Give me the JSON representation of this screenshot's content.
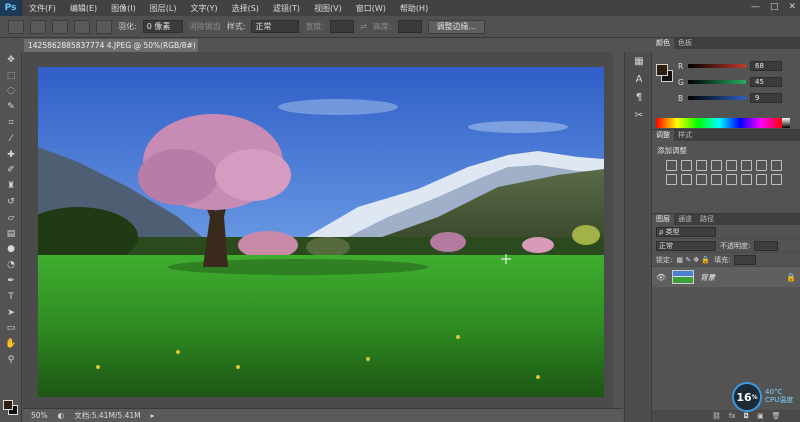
{
  "app": {
    "logo": "Ps"
  },
  "menu": [
    "文件(F)",
    "编辑(E)",
    "图像(I)",
    "图层(L)",
    "文字(Y)",
    "选择(S)",
    "滤镜(T)",
    "视图(V)",
    "窗口(W)",
    "帮助(H)"
  ],
  "window_controls": [
    "—",
    "□",
    "✕"
  ],
  "options": {
    "feather_label": "羽化:",
    "feather_value": "0 像素",
    "antialias_label": "消除锯齿",
    "style_label": "样式:",
    "style_value": "正常",
    "width_label": "宽度:",
    "height_label": "高度:",
    "refine_edge_button": "调整边缘..."
  },
  "document": {
    "tab_title": "1425862885837774 4.JPEG @ 50%(RGB/8#)",
    "close_icon": "×",
    "zoom": "50%",
    "doc_info": "文档:5.41M/5.41M"
  },
  "tools": [
    "move-tool",
    "marquee-tool",
    "lasso-tool",
    "quick-select-tool",
    "crop-tool",
    "eyedropper-tool",
    "healing-brush-tool",
    "brush-tool",
    "clone-stamp-tool",
    "history-brush-tool",
    "eraser-tool",
    "gradient-tool",
    "blur-tool",
    "dodge-tool",
    "pen-tool",
    "type-tool",
    "path-select-tool",
    "shape-tool",
    "hand-tool",
    "zoom-tool"
  ],
  "color_panel": {
    "tabs": [
      "颜色",
      "色板"
    ],
    "channels": [
      {
        "label": "R",
        "value": "68",
        "color": "#c0392b"
      },
      {
        "label": "G",
        "value": "45",
        "color": "#27ae60"
      },
      {
        "label": "B",
        "value": "9",
        "color": "#2c5fbf"
      }
    ],
    "foreground": "#2e1d0c",
    "background": "#111111"
  },
  "adjustments_panel": {
    "tabs": [
      "调整",
      "样式"
    ],
    "title": "添加调整"
  },
  "layers_panel": {
    "tabs": [
      "图层",
      "通道",
      "路径"
    ],
    "filter_label": "ρ 类型",
    "blend_mode": "正常",
    "opacity_label": "不透明度:",
    "lock_label": "锁定:",
    "fill_label": "填充:",
    "layers": [
      {
        "name": "背景",
        "locked": true
      }
    ]
  },
  "cpu": {
    "percent": "16",
    "percent_unit": "%",
    "temp": "40°C",
    "label": "CPU温度"
  }
}
